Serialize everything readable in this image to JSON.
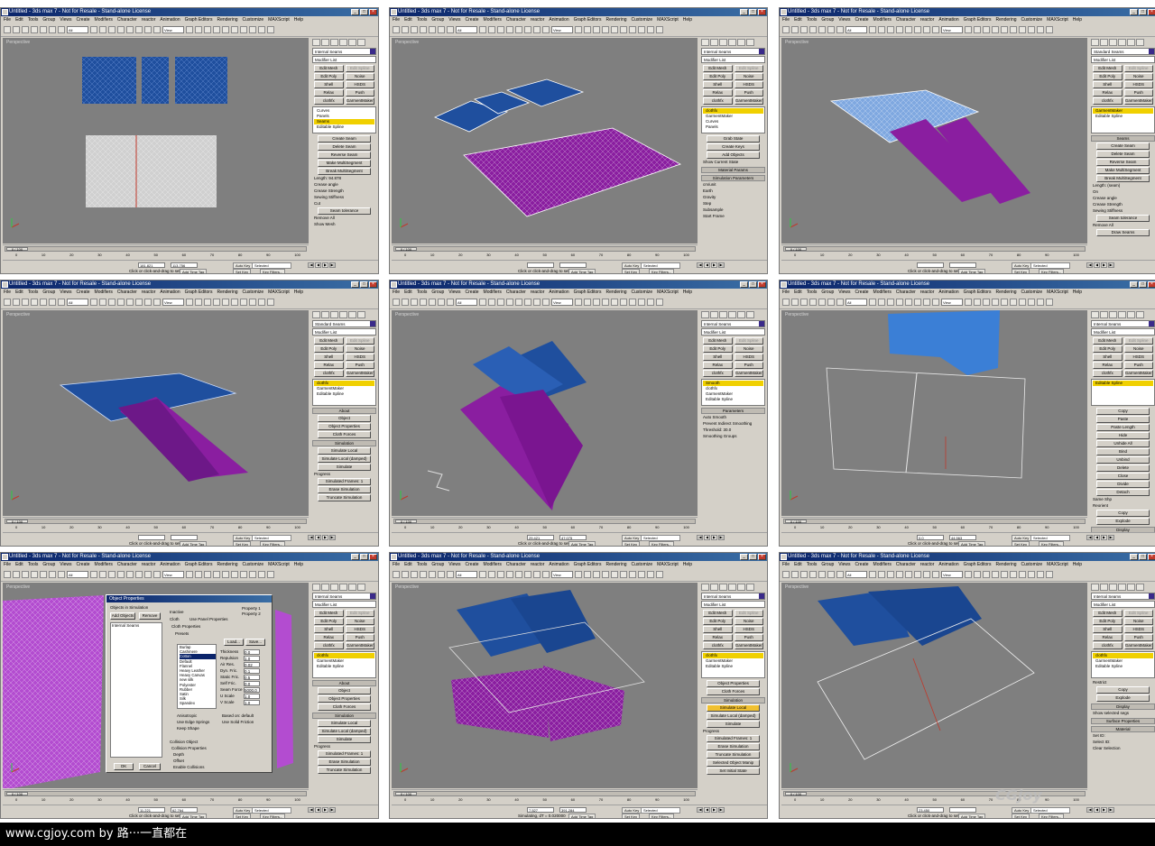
{
  "window": {
    "title": "Untitled - 3ds max 7 - Not for Resale - Stand-alone License",
    "menu": [
      "File",
      "Edit",
      "Tools",
      "Group",
      "Views",
      "Create",
      "Modifiers",
      "Character",
      "reactor",
      "Animation",
      "Graph Editors",
      "Rendering",
      "Customize",
      "MAXScript",
      "Help"
    ],
    "toolbar": {
      "selection_filter": "All",
      "ref_coord": "View"
    },
    "viewport_label": "Perspective",
    "status": {
      "frame": "0 / 100",
      "time_ticks": [
        "0",
        "10",
        "20",
        "30",
        "40",
        "50",
        "60",
        "70",
        "80",
        "90",
        "100"
      ],
      "prompt": "Click or click-and-drag to select objects",
      "add_time_tag": "Add Time Tag",
      "auto_key": "Auto Key",
      "selected": "Selected",
      "set_key": "Set Key",
      "key_filters": "Key Filters..."
    }
  },
  "command_panel": {
    "modifier_list": "Modifier List",
    "buttons": [
      "Edit Mesh",
      "Edit Spline",
      "Edit Poly",
      "Noise",
      "Shell",
      "HSDS",
      "Relax",
      "Push",
      "clothfx",
      "GarmentMaker"
    ]
  },
  "panels": [
    {
      "object": "Internal Seams",
      "stack": [
        "Curves",
        "Panels",
        "Seams",
        "Editable Spline"
      ],
      "rollouts": [
        "Create Seam",
        "Delete Seam",
        "Reverse Seam",
        "Make MultiSegment",
        "Break MultiSegment",
        "Length: 94.878",
        "Crease angle",
        "Crease Strength",
        "Sewing Stiffness",
        "Cut",
        "Seam tolerance",
        "Remove All",
        "Show Mesh"
      ],
      "coords": [
        "181.821",
        "113.756"
      ]
    },
    {
      "object": "Internal Seams",
      "stack": [
        "clothfx",
        "GarmentMaker",
        "Curves",
        "Panels"
      ],
      "rollouts": [
        "Grab State",
        "Create Keys",
        "Add Objects",
        "Show Current State",
        "Material Params",
        "Simulation Parameters",
        "cm/unit",
        "Earth",
        "Gravity",
        "Step",
        "Subsample",
        "Start Frame"
      ],
      "coords": [
        "",
        ""
      ]
    },
    {
      "object": "Standard Seams",
      "stack": [
        "GarmentMaker",
        "Editable Spline"
      ],
      "rollouts": [
        "Seams",
        "Create Seam",
        "Delete Seam",
        "Reverse Seam",
        "Make MultiSegment",
        "Break MultiSegment",
        "Length: (seam)",
        "On",
        "Crease angle",
        "Crease Strength",
        "Sewing Stiffness",
        "Seam tolerance",
        "Remove All",
        "Draw Seams"
      ],
      "coords": [
        "",
        ""
      ]
    },
    {
      "object": "Standard Seams",
      "stack": [
        "clothfx",
        "GarmentMaker",
        "Editable Spline"
      ],
      "rollouts": [
        "About",
        "Object",
        "Object Properties",
        "Cloth Forces",
        "Simulation",
        "Simulate Local",
        "Simulate Local (damped)",
        "Simulate",
        "Progress",
        "Simulated Frames: 1",
        "Erase Simulation",
        "Truncate Simulation"
      ],
      "coords": [
        "",
        ""
      ]
    },
    {
      "object": "Internal Seams",
      "stack": [
        "Smooth",
        "clothfx",
        "GarmentMaker",
        "Editable Spline"
      ],
      "rollouts": [
        "Parameters",
        "Auto Smooth",
        "Prevent Indirect Smoothing",
        "Threshold: 30.0",
        "Smoothing Groups"
      ],
      "coords": [
        "29.421",
        "47.075"
      ]
    },
    {
      "object": "Internal Seams",
      "stack": [
        "Editable Spline"
      ],
      "rollouts": [
        "Copy",
        "Paste",
        "Paste Length",
        "Hide",
        "Unhide All",
        "Bind",
        "Unbind",
        "Delete",
        "Close",
        "Divide",
        "Detach",
        "Same Shp",
        "Reorient",
        "Copy",
        "Explode",
        "Display",
        "Show selected segs"
      ],
      "coords": [
        "0.0",
        "44.563"
      ]
    },
    {
      "object": "Internal Seams",
      "stack": [
        "clothfx",
        "GarmentMaker",
        "Editable Spline"
      ],
      "rollouts": [
        "About",
        "Object",
        "Object Properties",
        "Cloth Forces",
        "Simulation",
        "Simulate Local",
        "Simulate Local (damped)",
        "Simulate",
        "Progress",
        "Simulated Frames: 1",
        "Erase Simulation",
        "Truncate Simulation"
      ],
      "coords": [
        "11.221",
        "62.764"
      ]
    },
    {
      "object": "Internal Seams",
      "stack": [
        "clothfx",
        "GarmentMaker",
        "Editable Spline"
      ],
      "rollouts": [
        "Object Properties",
        "Cloth Forces",
        "Simulation",
        "Simulate Local",
        "Simulate Local (damped)",
        "Simulate",
        "Progress",
        "Simulated Frames: 1",
        "Erase Simulation",
        "Truncate Simulation",
        "Selected Object Manip",
        "Set Initial State"
      ],
      "coords": [
        "7.527",
        "391.284"
      ],
      "prompt": "Simulating, dT = 0.020000"
    },
    {
      "object": "Internal Seams",
      "stack": [
        "clothfx",
        "GarmentMaker",
        "Editable Spline"
      ],
      "rollouts": [
        "Restrict",
        "Copy",
        "Explode",
        "Display",
        "Show selected segs",
        "Surface Properties",
        "Material",
        "Set ID:",
        "Select ID:",
        "Clear Selection"
      ],
      "coords": [
        "23.450",
        ""
      ]
    }
  ],
  "object_properties_dialog": {
    "title": "Object Properties",
    "objects_label": "Objects in Simulation",
    "add_objects": "Add Objects",
    "remove": "Remove",
    "list": [
      "Internal Seams"
    ],
    "inactive": "Inactive",
    "cloth": "Cloth",
    "use_panel_properties": "Use Panel Properties",
    "property1": "Property 1",
    "property2": "Property 2",
    "cloth_properties": "Cloth Properties",
    "presets_label": "Presets",
    "presets": [
      "Burlap",
      "Cashmere",
      "Cotton",
      "Default",
      "Flannel",
      "Heavy Leather",
      "Heavy Canvas",
      "new silk",
      "Polyester",
      "Rubber",
      "Satin",
      "Silk",
      "Spandex"
    ],
    "load": "Load...",
    "save": "Save...",
    "params": [
      "Thickness",
      "Repulsion",
      "Air Res.",
      "Dyn. Fric.",
      "Static Fric.",
      "Self Fric.",
      "Seam Force",
      "U Scale",
      "V Scale"
    ],
    "values": [
      "0.0",
      "1.0",
      "0.02",
      "0.1",
      "0.5",
      "0.0",
      "5000.0",
      "1.0",
      "1.0"
    ],
    "anisotropic": "Anisotropic",
    "use_edge_springs": "Use Edge Springs",
    "keep_shape": "Keep Shape",
    "use_solid_friction": "Use Solid Friction",
    "based_on": "Based on: default",
    "collision_object": "Collision Object",
    "collision_properties": "Collision Properties",
    "depth": "Depth",
    "offset": "Offset",
    "enable_collisions": "Enable Collisions",
    "ok": "OK",
    "cancel": "Cancel"
  },
  "watermark": "CGjoy",
  "footer": "www.cgjoy.com by 路···一直都在",
  "colors": {
    "cloth_blue": "#1f4f9e",
    "cloth_purple": "#8a1ea0",
    "viewport": "#7f7f7f",
    "titlebar": "#0a246a",
    "highlight": "#f0d000"
  }
}
